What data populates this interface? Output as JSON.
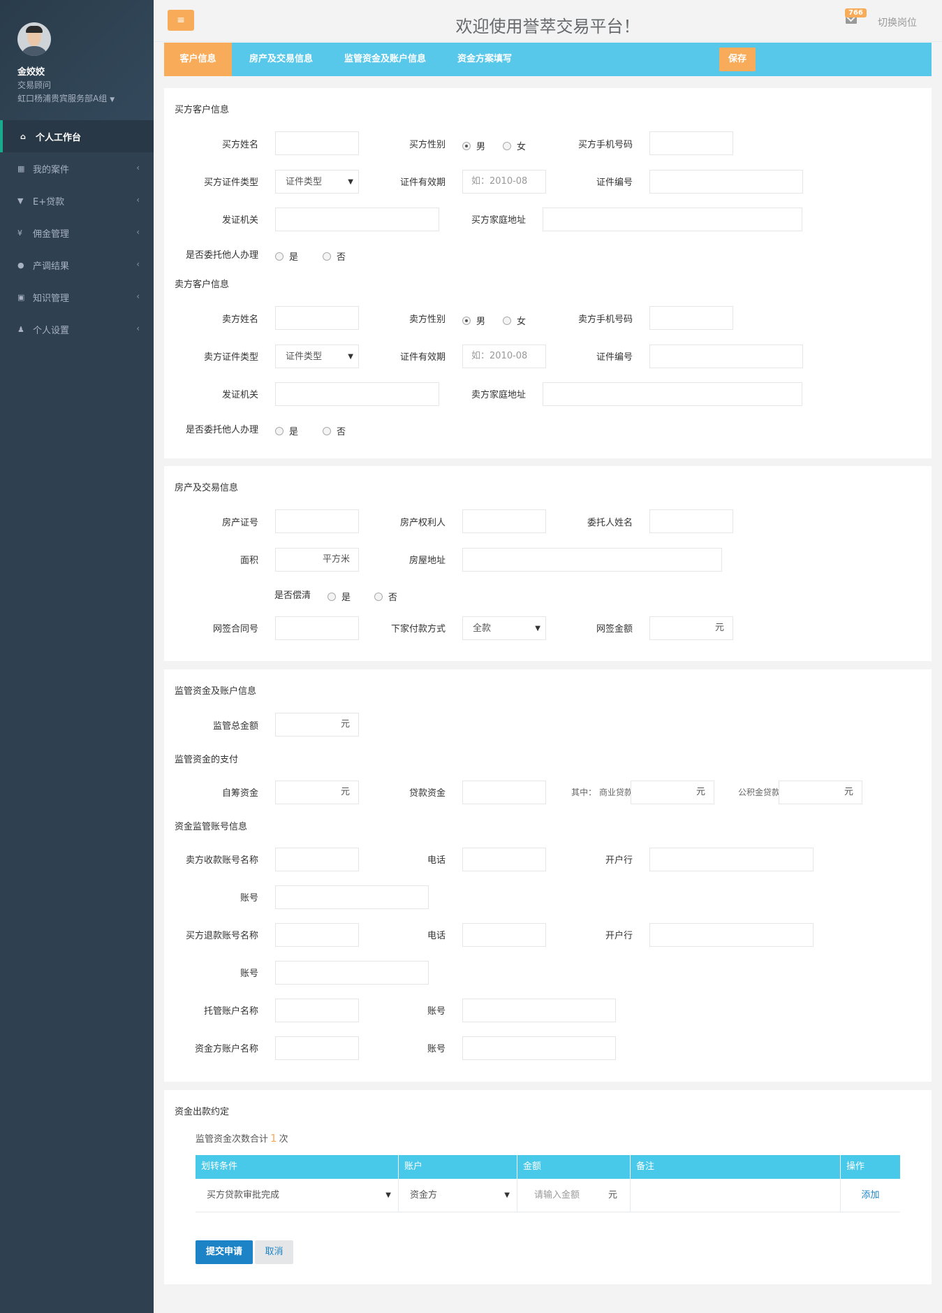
{
  "user": {
    "name": "金姣姣",
    "role": "交易顾问",
    "dept": "虹口杨浦贵宾服务部A组"
  },
  "nav": [
    {
      "label": "个人工作台"
    },
    {
      "label": "我的案件"
    },
    {
      "label": "E+贷款"
    },
    {
      "label": "佣金管理"
    },
    {
      "label": "产调结果"
    },
    {
      "label": "知识管理"
    },
    {
      "label": "个人设置"
    }
  ],
  "topbar": {
    "welcome": "欢迎使用誉萃交易平台！",
    "badge": "766",
    "switch": "切换岗位"
  },
  "tabs": [
    "客户信息",
    "房产及交易信息",
    "监管资金及账户信息",
    "资金方案填写"
  ],
  "save": "保存",
  "buyer": {
    "section": "买方客户信息",
    "name": "买方姓名",
    "gender": "买方性别",
    "male": "男",
    "female": "女",
    "phone": "买方手机号码",
    "idtype": "买方证件类型",
    "idtype_value": "证件类型",
    "validity": "证件有效期",
    "validity_ph": "如：2010-08",
    "idno": "证件编号",
    "authority": "发证机关",
    "address": "买方家庭地址",
    "delegate": "是否委托他人办理",
    "yes": "是",
    "no": "否"
  },
  "seller": {
    "section": "卖方客户信息",
    "name": "卖方姓名",
    "gender": "卖方性别",
    "male": "男",
    "female": "女",
    "phone": "卖方手机号码",
    "idtype": "卖方证件类型",
    "idtype_value": "证件类型",
    "validity": "证件有效期",
    "validity_ph": "如：2010-08",
    "idno": "证件编号",
    "authority": "发证机关",
    "address": "卖方家庭地址",
    "delegate": "是否委托他人办理",
    "yes": "是",
    "no": "否"
  },
  "property": {
    "section": "房产及交易信息",
    "cert": "房产证号",
    "owner": "房产权利人",
    "delegate_name": "委托人姓名",
    "area": "面积",
    "area_unit": "平方米",
    "address": "房屋地址",
    "cleared": "是否偿清",
    "yes": "是",
    "no": "否",
    "contract": "网签合同号",
    "pay_method": "下家付款方式",
    "pay_method_value": "全款",
    "contract_amount": "网签金额",
    "yuan": "元"
  },
  "funds": {
    "section": "监管资金及账户信息",
    "total": "监管总金额",
    "yuan": "元",
    "payment_section": "监管资金的支付",
    "self": "自筹资金",
    "loan": "贷款资金",
    "commercial": "其中：  商业贷款",
    "provident": "公积金贷款",
    "account_section": "资金监管账号信息",
    "seller_acct": "卖方收款账号名称",
    "phone": "电话",
    "bank": "开户行",
    "acct_no": "账号",
    "buyer_refund": "买方退款账号名称",
    "custody": "托管账户名称",
    "funder": "资金方账户名称"
  },
  "payout": {
    "section": "资金出款约定",
    "count_prefix": "监管资金次数合计",
    "count": "1",
    "count_suffix": "次",
    "headers": [
      "划转条件",
      "账户",
      "金额",
      "备注",
      "操作"
    ],
    "row": {
      "condition": "买方贷款审批完成",
      "account": "资金方",
      "amount_ph": "请输入金额",
      "yuan": "元",
      "action": "添加"
    },
    "submit": "提交申请",
    "cancel": "取消"
  }
}
